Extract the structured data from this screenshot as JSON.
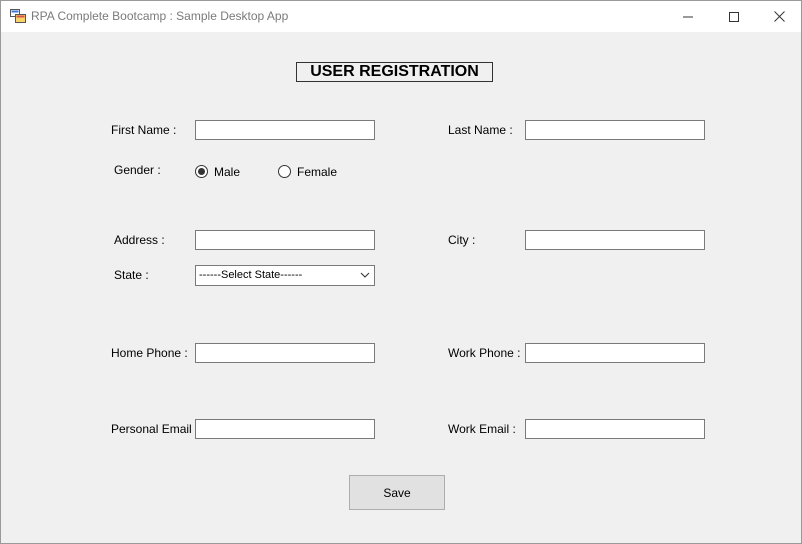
{
  "window": {
    "title": "RPA Complete Bootcamp : Sample Desktop App",
    "icons": {
      "app": "app-icon",
      "minimize": "minimize-icon",
      "maximize": "maximize-icon",
      "close": "close-icon"
    }
  },
  "form": {
    "heading": "USER REGISTRATION",
    "first_name": {
      "label": "First Name :",
      "value": ""
    },
    "last_name": {
      "label": "Last Name :",
      "value": ""
    },
    "gender": {
      "label": "Gender :",
      "options": [
        "Male",
        "Female"
      ],
      "selected": "Male"
    },
    "address": {
      "label": "Address :",
      "value": ""
    },
    "city": {
      "label": "City :",
      "value": ""
    },
    "state": {
      "label": "State :",
      "selected": "------Select State------"
    },
    "home_phone": {
      "label": "Home Phone :",
      "value": ""
    },
    "work_phone": {
      "label": "Work Phone :",
      "value": ""
    },
    "personal_email": {
      "label": "Personal Email :",
      "value": ""
    },
    "work_email": {
      "label": "Work Email :",
      "value": ""
    },
    "save_label": "Save"
  }
}
